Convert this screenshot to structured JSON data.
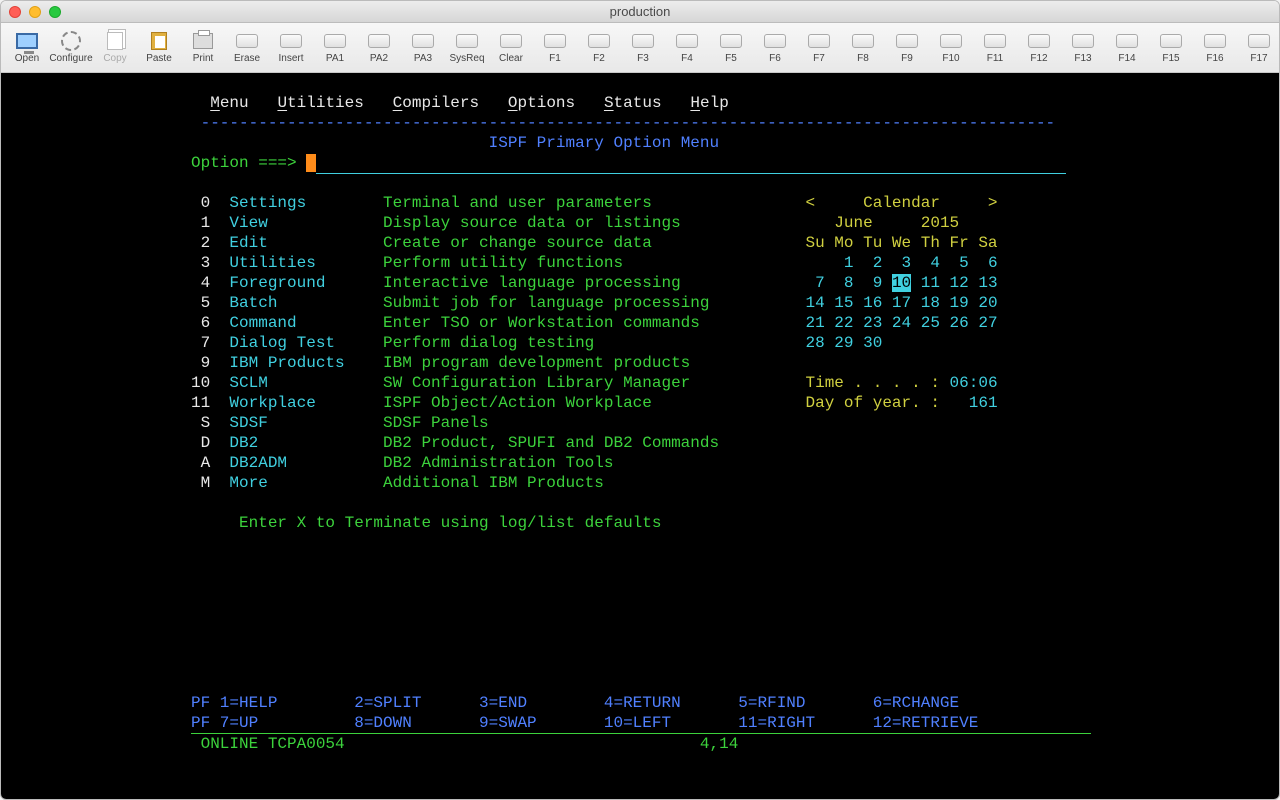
{
  "window": {
    "title": "production"
  },
  "toolbar": {
    "buttons": [
      {
        "label": "Open",
        "icon": "monitor"
      },
      {
        "label": "Configure",
        "icon": "gear"
      },
      {
        "label": "Copy",
        "icon": "copy",
        "disabled": true
      },
      {
        "label": "Paste",
        "icon": "paste"
      },
      {
        "label": "Print",
        "icon": "print"
      }
    ],
    "keys": [
      "Erase",
      "Insert",
      "PA1",
      "PA2",
      "PA3",
      "SysReq",
      "Clear",
      "F1",
      "F2",
      "F3",
      "F4",
      "F5",
      "F6",
      "F7",
      "F8",
      "F9",
      "F10",
      "F11",
      "F12",
      "F13",
      "F14",
      "F15",
      "F16",
      "F17"
    ]
  },
  "menu": [
    "Menu",
    "Utilities",
    "Compilers",
    "Options",
    "Status",
    "Help"
  ],
  "title": "ISPF Primary Option Menu",
  "optionPrompt": "Option ===>",
  "options": [
    {
      "num": "0",
      "name": "Settings",
      "desc": "Terminal and user parameters"
    },
    {
      "num": "1",
      "name": "View",
      "desc": "Display source data or listings"
    },
    {
      "num": "2",
      "name": "Edit",
      "desc": "Create or change source data"
    },
    {
      "num": "3",
      "name": "Utilities",
      "desc": "Perform utility functions"
    },
    {
      "num": "4",
      "name": "Foreground",
      "desc": "Interactive language processing"
    },
    {
      "num": "5",
      "name": "Batch",
      "desc": "Submit job for language processing"
    },
    {
      "num": "6",
      "name": "Command",
      "desc": "Enter TSO or Workstation commands"
    },
    {
      "num": "7",
      "name": "Dialog Test",
      "desc": "Perform dialog testing"
    },
    {
      "num": "9",
      "name": "IBM Products",
      "desc": "IBM program development products"
    },
    {
      "num": "10",
      "name": "SCLM",
      "desc": "SW Configuration Library Manager"
    },
    {
      "num": "11",
      "name": "Workplace",
      "desc": "ISPF Object/Action Workplace"
    },
    {
      "num": "S",
      "name": "SDSF",
      "desc": "SDSF Panels"
    },
    {
      "num": "D",
      "name": "DB2",
      "desc": "DB2 Product, SPUFI and DB2 Commands"
    },
    {
      "num": "A",
      "name": "DB2ADM",
      "desc": "DB2 Administration Tools"
    },
    {
      "num": "M",
      "name": "More",
      "desc": "Additional IBM Products"
    }
  ],
  "footer_msg": "Enter X to Terminate using log/list defaults",
  "calendar": {
    "label": "Calendar",
    "prev": "<",
    "next": ">",
    "month": "June",
    "year": "2015",
    "dow": [
      "Su",
      "Mo",
      "Tu",
      "We",
      "Th",
      "Fr",
      "Sa"
    ],
    "weeks": [
      [
        "",
        "1",
        "2",
        "3",
        "4",
        "5",
        "6"
      ],
      [
        "7",
        "8",
        "9",
        "10",
        "11",
        "12",
        "13"
      ],
      [
        "14",
        "15",
        "16",
        "17",
        "18",
        "19",
        "20"
      ],
      [
        "21",
        "22",
        "23",
        "24",
        "25",
        "26",
        "27"
      ],
      [
        "28",
        "29",
        "30",
        "",
        "",
        "",
        ""
      ]
    ],
    "today": "10",
    "time_label": "Time . . . . :",
    "time": "06:06",
    "doy_label": "Day of year. :",
    "doy": "161"
  },
  "pfkeys": {
    "row1": [
      {
        "k": "PF 1",
        "v": "HELP"
      },
      {
        "k": "2",
        "v": "SPLIT"
      },
      {
        "k": "3",
        "v": "END"
      },
      {
        "k": "4",
        "v": "RETURN"
      },
      {
        "k": "5",
        "v": "RFIND"
      },
      {
        "k": "6",
        "v": "RCHANGE"
      }
    ],
    "row2": [
      {
        "k": "PF 7",
        "v": "UP"
      },
      {
        "k": "8",
        "v": "DOWN"
      },
      {
        "k": "9",
        "v": "SWAP"
      },
      {
        "k": "10",
        "v": "LEFT"
      },
      {
        "k": "11",
        "v": "RIGHT"
      },
      {
        "k": "12",
        "v": "RETRIEVE"
      }
    ]
  },
  "status": {
    "online": "ONLINE TCPA0054",
    "cursor": "4,14"
  }
}
